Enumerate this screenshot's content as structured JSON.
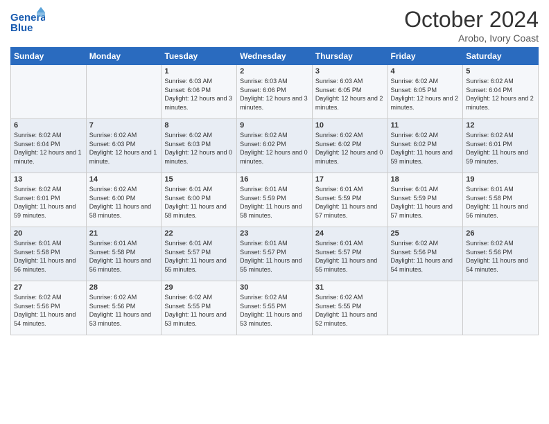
{
  "header": {
    "logo_line1": "General",
    "logo_line2": "Blue",
    "month": "October 2024",
    "location": "Arobo, Ivory Coast"
  },
  "days_of_week": [
    "Sunday",
    "Monday",
    "Tuesday",
    "Wednesday",
    "Thursday",
    "Friday",
    "Saturday"
  ],
  "weeks": [
    [
      {
        "day": "",
        "info": ""
      },
      {
        "day": "",
        "info": ""
      },
      {
        "day": "1",
        "info": "Sunrise: 6:03 AM\nSunset: 6:06 PM\nDaylight: 12 hours and 3 minutes."
      },
      {
        "day": "2",
        "info": "Sunrise: 6:03 AM\nSunset: 6:06 PM\nDaylight: 12 hours and 3 minutes."
      },
      {
        "day": "3",
        "info": "Sunrise: 6:03 AM\nSunset: 6:05 PM\nDaylight: 12 hours and 2 minutes."
      },
      {
        "day": "4",
        "info": "Sunrise: 6:02 AM\nSunset: 6:05 PM\nDaylight: 12 hours and 2 minutes."
      },
      {
        "day": "5",
        "info": "Sunrise: 6:02 AM\nSunset: 6:04 PM\nDaylight: 12 hours and 2 minutes."
      }
    ],
    [
      {
        "day": "6",
        "info": "Sunrise: 6:02 AM\nSunset: 6:04 PM\nDaylight: 12 hours and 1 minute."
      },
      {
        "day": "7",
        "info": "Sunrise: 6:02 AM\nSunset: 6:03 PM\nDaylight: 12 hours and 1 minute."
      },
      {
        "day": "8",
        "info": "Sunrise: 6:02 AM\nSunset: 6:03 PM\nDaylight: 12 hours and 0 minutes."
      },
      {
        "day": "9",
        "info": "Sunrise: 6:02 AM\nSunset: 6:02 PM\nDaylight: 12 hours and 0 minutes."
      },
      {
        "day": "10",
        "info": "Sunrise: 6:02 AM\nSunset: 6:02 PM\nDaylight: 12 hours and 0 minutes."
      },
      {
        "day": "11",
        "info": "Sunrise: 6:02 AM\nSunset: 6:02 PM\nDaylight: 11 hours and 59 minutes."
      },
      {
        "day": "12",
        "info": "Sunrise: 6:02 AM\nSunset: 6:01 PM\nDaylight: 11 hours and 59 minutes."
      }
    ],
    [
      {
        "day": "13",
        "info": "Sunrise: 6:02 AM\nSunset: 6:01 PM\nDaylight: 11 hours and 59 minutes."
      },
      {
        "day": "14",
        "info": "Sunrise: 6:02 AM\nSunset: 6:00 PM\nDaylight: 11 hours and 58 minutes."
      },
      {
        "day": "15",
        "info": "Sunrise: 6:01 AM\nSunset: 6:00 PM\nDaylight: 11 hours and 58 minutes."
      },
      {
        "day": "16",
        "info": "Sunrise: 6:01 AM\nSunset: 5:59 PM\nDaylight: 11 hours and 58 minutes."
      },
      {
        "day": "17",
        "info": "Sunrise: 6:01 AM\nSunset: 5:59 PM\nDaylight: 11 hours and 57 minutes."
      },
      {
        "day": "18",
        "info": "Sunrise: 6:01 AM\nSunset: 5:59 PM\nDaylight: 11 hours and 57 minutes."
      },
      {
        "day": "19",
        "info": "Sunrise: 6:01 AM\nSunset: 5:58 PM\nDaylight: 11 hours and 56 minutes."
      }
    ],
    [
      {
        "day": "20",
        "info": "Sunrise: 6:01 AM\nSunset: 5:58 PM\nDaylight: 11 hours and 56 minutes."
      },
      {
        "day": "21",
        "info": "Sunrise: 6:01 AM\nSunset: 5:58 PM\nDaylight: 11 hours and 56 minutes."
      },
      {
        "day": "22",
        "info": "Sunrise: 6:01 AM\nSunset: 5:57 PM\nDaylight: 11 hours and 55 minutes."
      },
      {
        "day": "23",
        "info": "Sunrise: 6:01 AM\nSunset: 5:57 PM\nDaylight: 11 hours and 55 minutes."
      },
      {
        "day": "24",
        "info": "Sunrise: 6:01 AM\nSunset: 5:57 PM\nDaylight: 11 hours and 55 minutes."
      },
      {
        "day": "25",
        "info": "Sunrise: 6:02 AM\nSunset: 5:56 PM\nDaylight: 11 hours and 54 minutes."
      },
      {
        "day": "26",
        "info": "Sunrise: 6:02 AM\nSunset: 5:56 PM\nDaylight: 11 hours and 54 minutes."
      }
    ],
    [
      {
        "day": "27",
        "info": "Sunrise: 6:02 AM\nSunset: 5:56 PM\nDaylight: 11 hours and 54 minutes."
      },
      {
        "day": "28",
        "info": "Sunrise: 6:02 AM\nSunset: 5:56 PM\nDaylight: 11 hours and 53 minutes."
      },
      {
        "day": "29",
        "info": "Sunrise: 6:02 AM\nSunset: 5:55 PM\nDaylight: 11 hours and 53 minutes."
      },
      {
        "day": "30",
        "info": "Sunrise: 6:02 AM\nSunset: 5:55 PM\nDaylight: 11 hours and 53 minutes."
      },
      {
        "day": "31",
        "info": "Sunrise: 6:02 AM\nSunset: 5:55 PM\nDaylight: 11 hours and 52 minutes."
      },
      {
        "day": "",
        "info": ""
      },
      {
        "day": "",
        "info": ""
      }
    ]
  ]
}
